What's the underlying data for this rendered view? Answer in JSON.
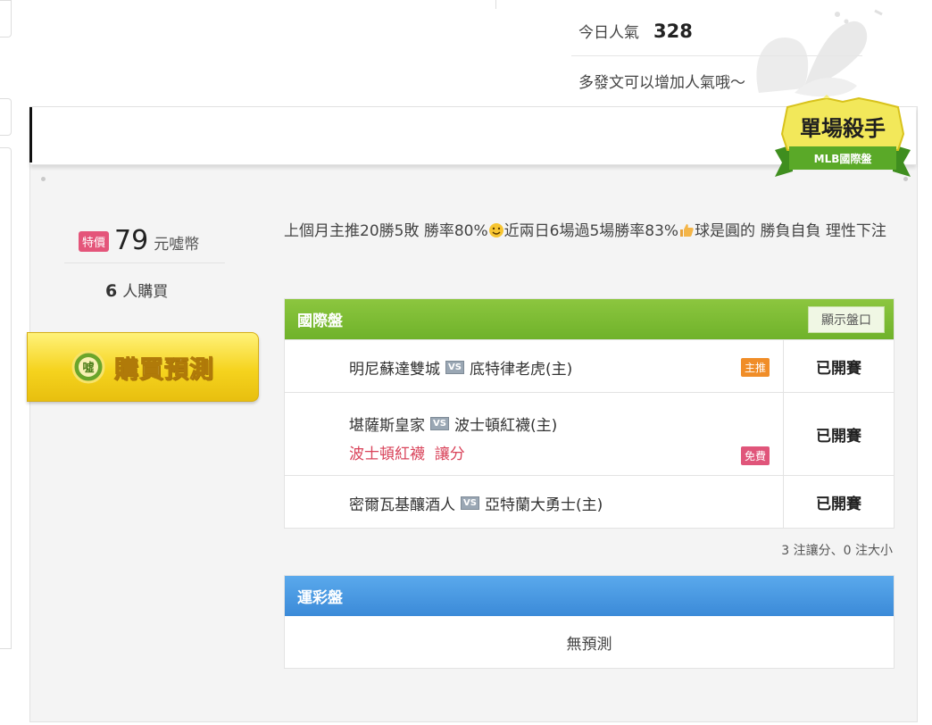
{
  "header": {
    "popularity_label": "今日人氣",
    "popularity_value": "328",
    "popularity_hint": "多發文可以增加人氣哦～"
  },
  "badge": {
    "title": "單場殺手",
    "subtitle": "MLB國際盤"
  },
  "offer": {
    "special_tag": "特價",
    "price": "79",
    "price_unit": "元噓幣",
    "buyers_count": "6",
    "buyers_label": "人購買",
    "buy_button_label": "購買預測",
    "buy_icon_text": "噓"
  },
  "description": {
    "part1": "上個月主推20勝5敗 勝率80%",
    "part2": "近兩日6場過5場勝率83%",
    "part3": "球是圓的 勝負自負 理性下注"
  },
  "international": {
    "title": "國際盤",
    "show_odds_label": "顯示盤口",
    "rows": [
      {
        "away": "明尼蘇達雙城",
        "vs": "VS",
        "home": "底特律老虎(主)",
        "pick": "",
        "tag": "主推",
        "status": "已開賽"
      },
      {
        "away": "堪薩斯皇家",
        "vs": "VS",
        "home": "波士頓紅襪(主)",
        "pick": "波士頓紅襪  讓分",
        "tag": "免費",
        "status": "已開賽"
      },
      {
        "away": "密爾瓦基釀酒人",
        "vs": "VS",
        "home": "亞特蘭大勇士(主)",
        "pick": "",
        "tag": "",
        "status": "已開賽"
      }
    ],
    "summary": "3 注讓分、0 注大小"
  },
  "lottery": {
    "title": "運彩盤",
    "empty_text": "無預測"
  },
  "colors": {
    "green_header": "#7ab833",
    "blue_header": "#4a99e2",
    "pick_red": "#d9435a",
    "tag_main": "#f08d28",
    "tag_free": "#e0557a",
    "buy_button": "#f5d31e"
  }
}
